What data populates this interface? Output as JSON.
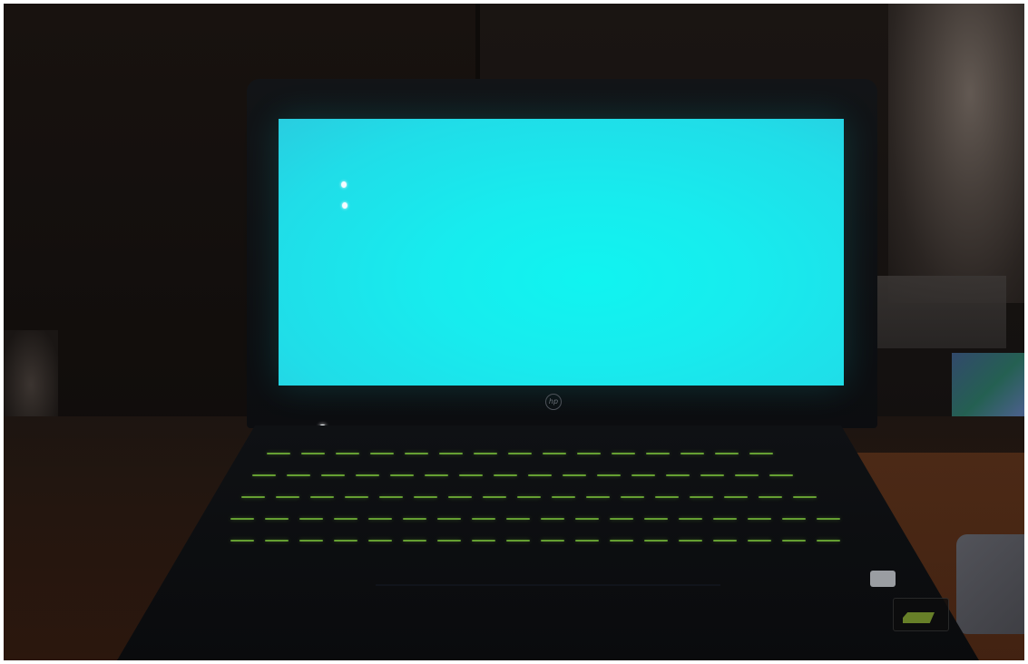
{
  "scene": {
    "screen_color": "#1ceef0",
    "keyboard_backlight_color": "#7cc43b",
    "brand_logo": "hp-logo-icon",
    "cursor_dots": 2
  }
}
